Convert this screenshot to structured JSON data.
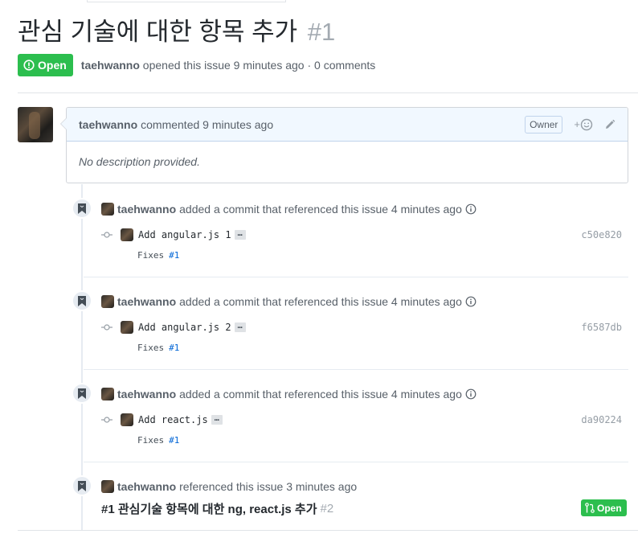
{
  "issue": {
    "title": "관심 기술에 대한 항목 추가",
    "number": "#1",
    "state": "Open",
    "author": "taehwanno",
    "opened_text": "opened this issue 9 minutes ago · 0 comments"
  },
  "comment": {
    "author": "taehwanno",
    "action": "commented 9 minutes ago",
    "owner_badge": "Owner",
    "reaction_label": "+",
    "body": "No description provided."
  },
  "events": [
    {
      "author": "taehwanno",
      "action": "added a commit that referenced this issue 4 minutes ago",
      "commit": {
        "message": "Add angular.js 1",
        "sha": "c50e820",
        "fixes_label": "Fixes",
        "fixes_ref": "#1"
      }
    },
    {
      "author": "taehwanno",
      "action": "added a commit that referenced this issue 4 minutes ago",
      "commit": {
        "message": "Add angular.js 2",
        "sha": "f6587db",
        "fixes_label": "Fixes",
        "fixes_ref": "#1"
      }
    },
    {
      "author": "taehwanno",
      "action": "added a commit that referenced this issue 4 minutes ago",
      "commit": {
        "message": "Add react.js",
        "sha": "da90224",
        "fixes_label": "Fixes",
        "fixes_ref": "#1"
      }
    }
  ],
  "reference": {
    "author": "taehwanno",
    "action": "referenced this issue 3 minutes ago",
    "title": "#1 관심기술 항목에 대한 ng, react.js 추가",
    "number": "#2",
    "state": "Open"
  },
  "ellipsis": "…",
  "colors": {
    "open_green": "#2cbe4e",
    "link_blue": "#0366d6",
    "muted": "#586069"
  },
  "icons": [
    "issue-opened-icon",
    "bookmark-icon",
    "info-icon",
    "commit-icon",
    "smiley-icon",
    "pencil-icon",
    "pull-request-icon"
  ]
}
